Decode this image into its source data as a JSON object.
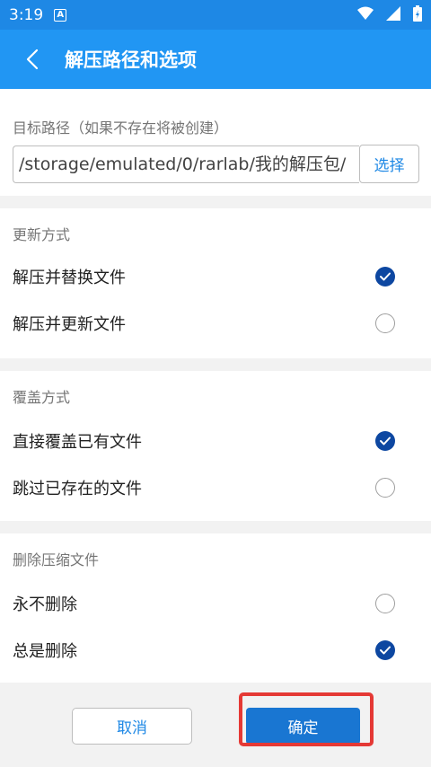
{
  "status_bar": {
    "time": "3:19",
    "notif_label": "A"
  },
  "app_bar": {
    "title": "解压路径和选项"
  },
  "path": {
    "label": "目标路径（如果不存在将被创建）",
    "value": "/storage/emulated/0/rarlab/我的解压包/",
    "choose_label": "选择"
  },
  "groups": [
    {
      "title": "更新方式",
      "options": [
        {
          "label": "解压并替换文件",
          "selected": true
        },
        {
          "label": "解压并更新文件",
          "selected": false
        }
      ]
    },
    {
      "title": "覆盖方式",
      "options": [
        {
          "label": "直接覆盖已有文件",
          "selected": true
        },
        {
          "label": "跳过已存在的文件",
          "selected": false
        }
      ]
    },
    {
      "title": "删除压缩文件",
      "options": [
        {
          "label": "永不删除",
          "selected": false
        },
        {
          "label": "总是删除",
          "selected": true
        }
      ]
    }
  ],
  "footer": {
    "cancel_label": "取消",
    "ok_label": "确定"
  },
  "colors": {
    "primary": "#2196f3",
    "status": "#1e88e5",
    "radio_on": "#0d47a1",
    "highlight": "#e53935"
  }
}
